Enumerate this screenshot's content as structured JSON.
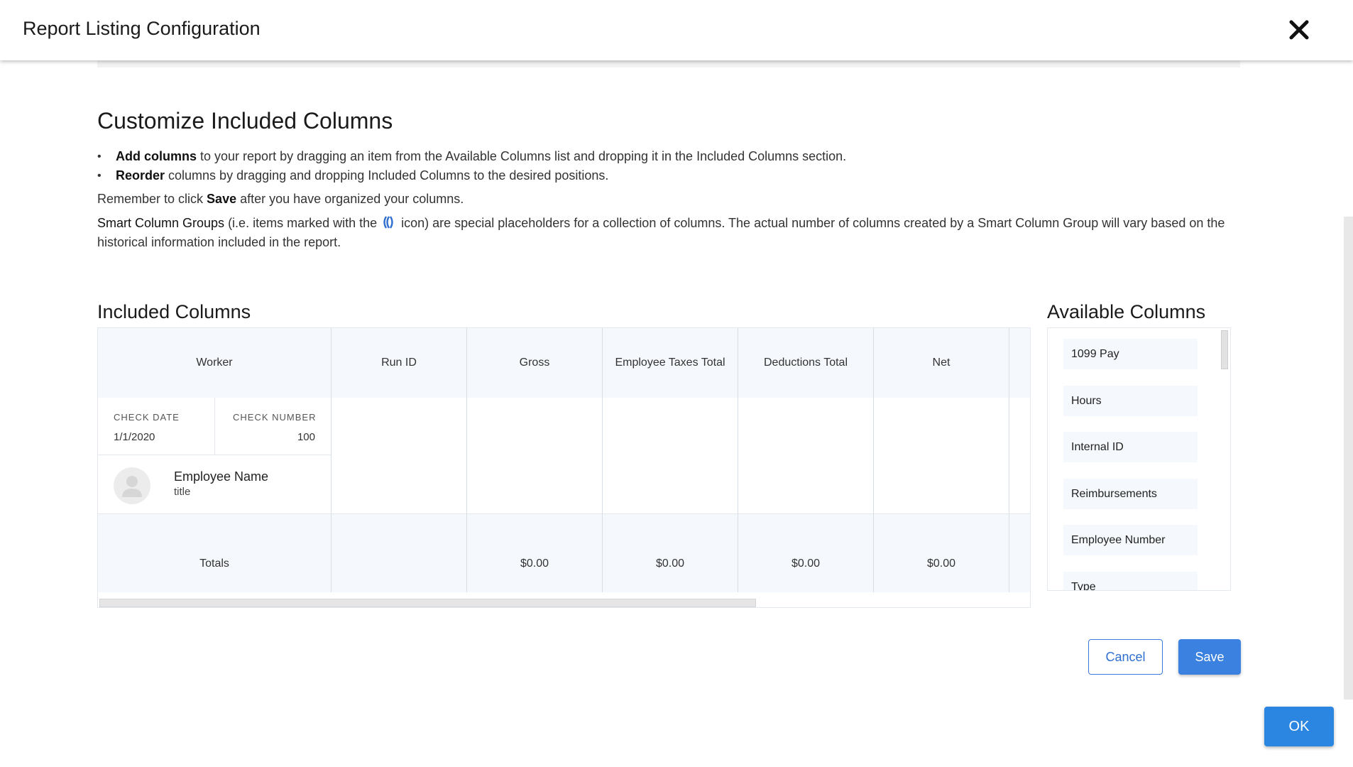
{
  "modal": {
    "title": "Report Listing Configuration"
  },
  "customize": {
    "title": "Customize Included Columns",
    "bullets": [
      {
        "bold": "Add columns",
        "text": " to your report by dragging an item from the Available Columns list and dropping it in the Included Columns section."
      },
      {
        "bold": "Reorder",
        "text": " columns by dragging and dropping Included Columns to the desired positions."
      }
    ],
    "remember_before": "Remember to click ",
    "remember_bold": "Save",
    "remember_after": " after you have organized your columns.",
    "smart_bold": "Smart Column Groups",
    "smart_before_icon": " (i.e. items marked with the ",
    "smart_after_icon": " icon) are special placeholders for a collection of columns. The actual number of columns created by a Smart Column Group will vary based on the historical information included in the report."
  },
  "included": {
    "title": "Included Columns",
    "worker": {
      "header": "Worker",
      "check_date_label": "CHECK DATE",
      "check_date_value": "1/1/2020",
      "check_number_label": "CHECK NUMBER",
      "check_number_value": "100",
      "employee_name": "Employee Name",
      "employee_title": "title",
      "totals_label": "Totals"
    },
    "columns": [
      {
        "header": "Run ID",
        "total": ""
      },
      {
        "header": "Gross",
        "total": "$0.00"
      },
      {
        "header": "Employee Taxes Total",
        "total": "$0.00"
      },
      {
        "header": "Deductions Total",
        "total": "$0.00"
      },
      {
        "header": "Net",
        "total": "$0.00"
      }
    ]
  },
  "available": {
    "title": "Available Columns",
    "items": [
      "1099 Pay",
      "Hours",
      "Internal ID",
      "Reimbursements",
      "Employee Number",
      "Type"
    ]
  },
  "buttons": {
    "cancel": "Cancel",
    "save": "Save",
    "ok": "OK"
  },
  "colors": {
    "accent": "#3b82e0",
    "header_bg": "#f5f8fc"
  }
}
